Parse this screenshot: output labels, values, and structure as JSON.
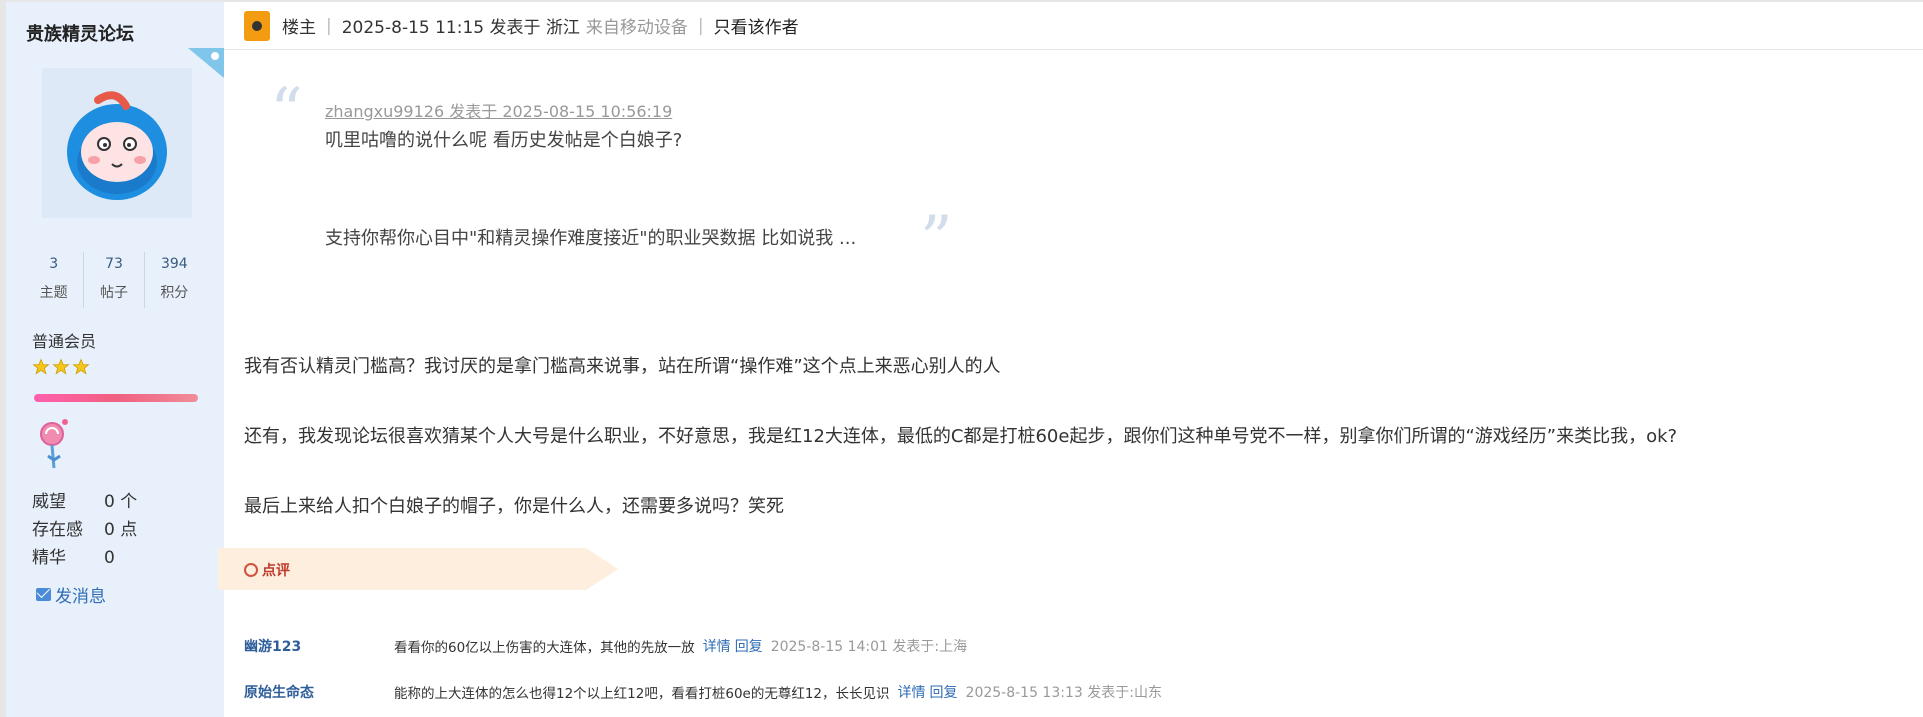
{
  "sidebar": {
    "forum_title": "贵族精灵论坛",
    "stats": [
      {
        "value": "3",
        "label": "主题"
      },
      {
        "value": "73",
        "label": "帖子"
      },
      {
        "value": "394",
        "label": "积分"
      }
    ],
    "rank": "普通会员",
    "star_count": 3,
    "properties": [
      {
        "key": "威望",
        "value": "0 个"
      },
      {
        "key": "存在感",
        "value": "0 点"
      },
      {
        "key": "精华",
        "value": "0"
      }
    ],
    "send_message": "发消息"
  },
  "header": {
    "role": "楼主",
    "post_time": "2025-8-15 11:15 发表于 浙江",
    "device": "来自移动设备",
    "only_author": "只看该作者"
  },
  "quote": {
    "meta": "zhangxu99126 发表于 2025-08-15 10:56:19",
    "line1": "叽里咕噜的说什么呢 看历史发帖是个白娘子?",
    "line2": "支持你帮你心目中\"和精灵操作难度接近\"的职业哭数据 比如说我 ..."
  },
  "paragraphs": [
    "我有否认精灵门槛高？我讨厌的是拿门槛高来说事，站在所谓“操作难”这个点上来恶心别人的人",
    "还有，我发现论坛很喜欢猜某个人大号是什么职业，不好意思，我是红12大连体，最低的C都是打桩60e起步，跟你们这种单号党不一样，别拿你们所谓的“游戏经历”来类比我，ok?",
    "最后上来给人扣个白娘子的帽子，你是什么人，还需要多说吗？笑死"
  ],
  "comments_label": "点评",
  "comments": [
    {
      "user": "幽游123",
      "text": "看看你的60亿以上伤害的大连体，其他的先放一放",
      "detail": "详情",
      "reply": "回复",
      "time": "2025-8-15 14:01 发表于:上海"
    },
    {
      "user": "原始生命态",
      "text": "能称的上大连体的怎么也得12个以上红12吧，看看打桩60e的无尊红12，长长见识",
      "detail": "详情",
      "reply": "回复",
      "time": "2025-8-15 13:13 发表于:山东"
    }
  ],
  "colors": {
    "sidebar_bg": "#e8f1fb",
    "accent_orange": "#f39c12",
    "link_blue": "#2f6db5",
    "comment_red": "#c0392b"
  }
}
